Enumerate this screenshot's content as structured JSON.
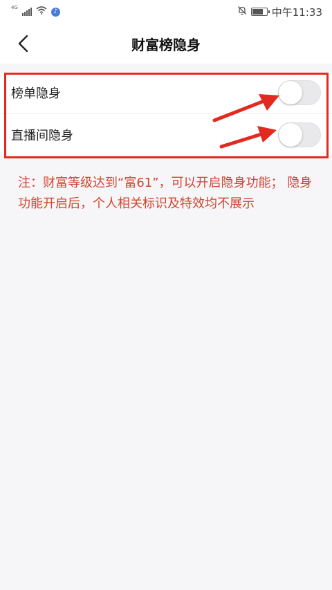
{
  "status_bar": {
    "network": "4G",
    "time": "中午11:33"
  },
  "header": {
    "title": "财富榜隐身"
  },
  "settings": {
    "items": [
      {
        "label": "榜单隐身",
        "enabled": false
      },
      {
        "label": "直播间隐身",
        "enabled": false
      }
    ]
  },
  "note": {
    "text": "注：财富等级达到“富61”，可以开启隐身功能； 隐身功能开启后，个人相关标识及特效均不展示"
  },
  "colors": {
    "annotation": "#e22a20",
    "note_text": "#d1452f",
    "toggle_off": "#e9e9ec"
  }
}
